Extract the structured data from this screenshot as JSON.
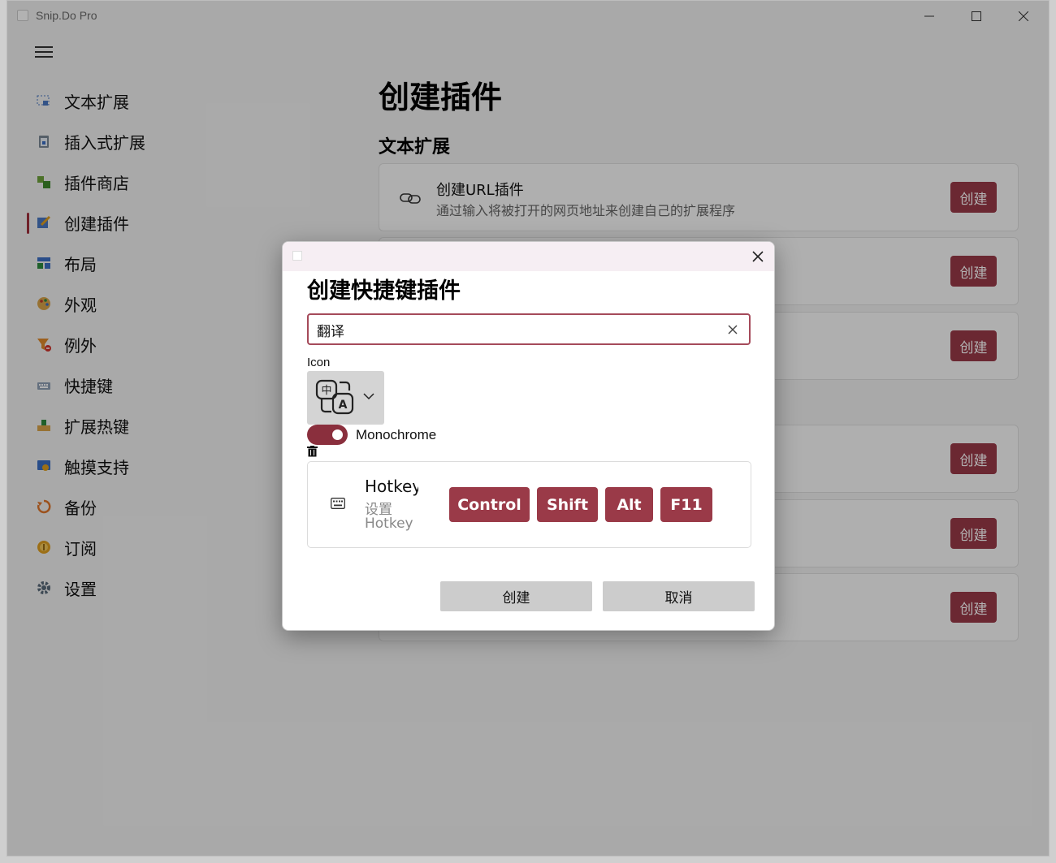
{
  "window": {
    "title": "Snip.Do Pro"
  },
  "sidebar": {
    "items": [
      {
        "label": "文本扩展",
        "icon": "text-select-icon"
      },
      {
        "label": "插入式扩展",
        "icon": "clipboard-icon"
      },
      {
        "label": "插件商店",
        "icon": "store-icon"
      },
      {
        "label": "创建插件",
        "icon": "edit-icon",
        "active": true
      },
      {
        "label": "布局",
        "icon": "layout-icon"
      },
      {
        "label": "外观",
        "icon": "palette-icon"
      },
      {
        "label": "例外",
        "icon": "filter-icon"
      },
      {
        "label": "快捷键",
        "icon": "keyboard-icon"
      },
      {
        "label": "扩展热键",
        "icon": "hotkey-icon"
      },
      {
        "label": "触摸支持",
        "icon": "touch-icon"
      },
      {
        "label": "备份",
        "icon": "backup-icon"
      },
      {
        "label": "订阅",
        "icon": "subscription-icon"
      },
      {
        "label": "设置",
        "icon": "gear-icon"
      }
    ]
  },
  "main": {
    "title": "创建插件",
    "section_title": "文本扩展",
    "cards": [
      {
        "title": "创建URL插件",
        "desc": "通过输入将被打开的网页地址来创建自己的扩展程序",
        "button": "创建"
      },
      {
        "title": "",
        "desc": "",
        "button": "创建"
      },
      {
        "title": "",
        "desc": "",
        "button": "创建"
      },
      {
        "title": "",
        "desc": "",
        "button": "创建"
      },
      {
        "title": "",
        "desc": "",
        "button": "创建"
      },
      {
        "title": "",
        "desc": "",
        "button": "创建"
      }
    ]
  },
  "dialog": {
    "title": "创建快捷键插件",
    "name_value": "翻译",
    "icon_label": "Icon",
    "icon_selected": "translate-icon",
    "monochrome_label": "Monochrome",
    "monochrome_on": true,
    "hotkey": {
      "title": "Hotkey",
      "subtitle_line1": "设置",
      "subtitle_line2": "Hotkey",
      "keys": [
        "Control",
        "Shift",
        "Alt",
        "F11"
      ]
    },
    "create_button": "创建",
    "cancel_button": "取消"
  },
  "colors": {
    "accent": "#9a3a48",
    "toggle": "#8a2f3d",
    "input_border": "#a54a5a"
  }
}
